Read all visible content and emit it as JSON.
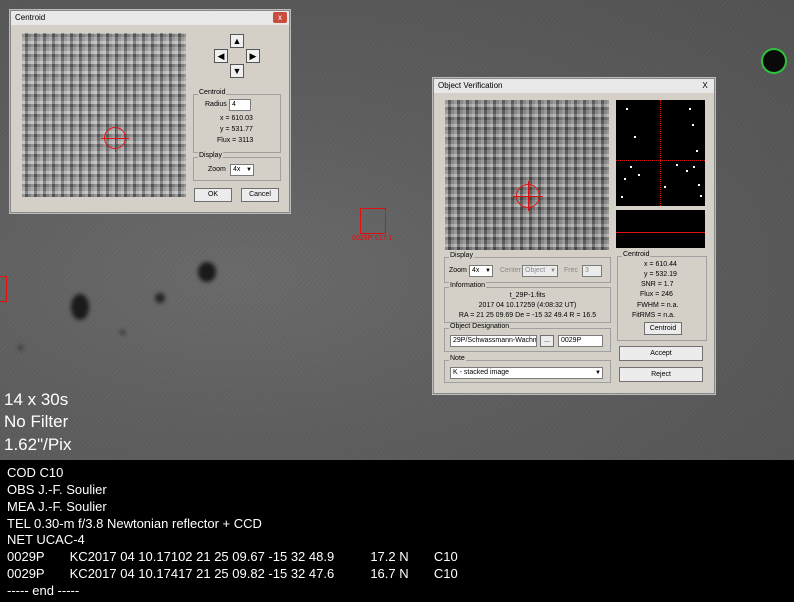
{
  "overlay": {
    "exposure": "14 x 30s",
    "filter": "No Filter",
    "scale": "1.62\"/Pix"
  },
  "sky_label": "0029P V17.1",
  "report": {
    "lines": [
      "COD C10",
      "OBS J.-F. Soulier",
      "MEA J.-F. Soulier",
      "TEL 0.30-m f/3.8 Newtonian reflector + CCD",
      "NET UCAC-4",
      "0029P       KC2017 04 10.17102 21 25 09.67 -15 32 48.9          17.2 N       C10",
      "0029P       KC2017 04 10.17417 21 25 09.82 -15 32 47.6          16.7 N       C10",
      "----- end -----"
    ]
  },
  "centroid_window": {
    "title": "Centroid",
    "close": "x",
    "arrows": {
      "up": "▲",
      "down": "▼",
      "left": "◀",
      "right": "▶"
    },
    "group_centroid": "Centroid",
    "radius_label": "Radius",
    "radius_value": "4",
    "x": "x = 610.03",
    "y": "y = 531.77",
    "flux": "Flux = 3113",
    "group_display": "Display",
    "zoom_label": "Zoom",
    "zoom_value": "4x",
    "ok": "OK",
    "cancel": "Cancel"
  },
  "verify_window": {
    "title": "Object Verification",
    "close": "X",
    "group_display": "Display",
    "zoom_label": "Zoom",
    "zoom_value": "4x",
    "center_label": "Center",
    "center_value": "Object",
    "frec_label": "Frec",
    "frec_value": "3",
    "group_info": "Information",
    "info_file": "t_29P-1.fits",
    "info_date": "2017 04 10.17259 (4:08:32 UT)",
    "info_coords": "RA = 21 25 09.69   De = -15 32 49.4   R = 16.5",
    "group_designation": "Object Designation",
    "designation_name": "29P/Schwassmann-Wachm",
    "designation_browse": "...",
    "designation_code": "0029P",
    "group_note": "Note",
    "note_value": "K - stacked image",
    "group_centroid": "Centroid",
    "cx": "x = 610.44",
    "cy": "y = 532.19",
    "snr": "SNR = 1.7",
    "flux": "Flux = 246",
    "fwhm": "FWHM = n.a.",
    "fitrms": "FitRMS = n.a.",
    "centroid_button": "Centroid",
    "accept": "Accept",
    "reject": "Reject"
  }
}
